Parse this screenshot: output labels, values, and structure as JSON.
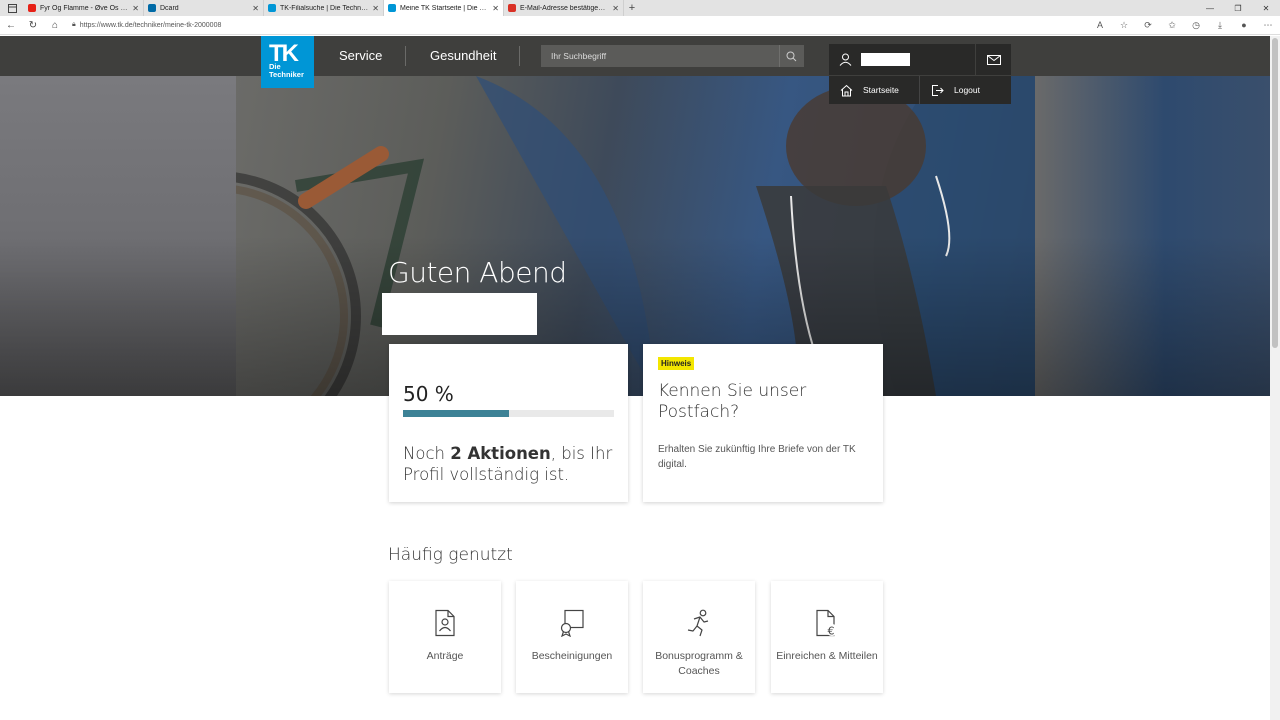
{
  "browser": {
    "tabs": [
      {
        "title": "Fyr Og Flamme - Øve Os På Hinanden",
        "color": "#e62117",
        "active": false
      },
      {
        "title": "Dcard",
        "color": "#006aa6",
        "active": false
      },
      {
        "title": "TK-Filialsuche | Die Techniker",
        "color": "#0096d6",
        "active": false
      },
      {
        "title": "Meine TK Startseite | Die Techniker",
        "color": "#0096d6",
        "active": true
      },
      {
        "title": "E-Mail-Adresse bestätigen - justin",
        "color": "#d93025",
        "active": false
      }
    ],
    "url": "https://www.tk.de/techniker/meine-tk-2000008"
  },
  "header": {
    "logo_main": "TK",
    "logo_sub_1": "Die",
    "logo_sub_2": "Techniker",
    "nav_service": "Service",
    "nav_gesundheit": "Gesundheit",
    "search_placeholder": "Ihr Suchbegriff",
    "brand_color": "#0096d6"
  },
  "dropdown": {
    "startseite": "Startseite",
    "logout": "Logout"
  },
  "hero": {
    "greeting": "Guten Abend"
  },
  "progress_card": {
    "percent_label": "50 %",
    "progress": 0.5,
    "text_before": "Noch ",
    "text_bold": "2 Aktionen",
    "text_after": ", bis Ihr Profil vollständig ist."
  },
  "hint_card": {
    "badge": "Hinweis",
    "title": "Kennen Sie unser Postfach?",
    "text": "Erhalten Sie zukünftig Ihre Briefe von der TK digital."
  },
  "frequent": {
    "title": "Häufig genutzt",
    "tiles": [
      {
        "label": "Anträge",
        "icon": "document-person-icon"
      },
      {
        "label": "Bescheinigungen",
        "icon": "certificate-icon"
      },
      {
        "label": "Bonusprogramm & Coaches",
        "icon": "running-person-icon"
      },
      {
        "label": "Einreichen & Mitteilen",
        "icon": "document-euro-icon"
      }
    ]
  }
}
